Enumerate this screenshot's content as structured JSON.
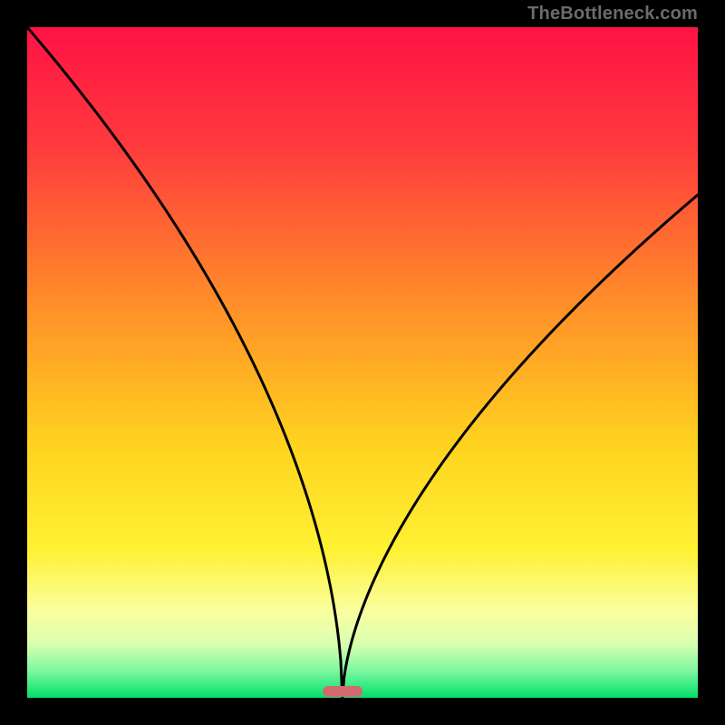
{
  "watermark": {
    "text": "TheBottleneck.com",
    "color": "#6b6b6b"
  },
  "chart_data": {
    "type": "line",
    "title": "",
    "xlabel": "",
    "ylabel": "",
    "xlim": [
      0,
      100
    ],
    "ylim": [
      0,
      100
    ],
    "minimum_x": 47,
    "x_samples": [
      0,
      5,
      10,
      15,
      20,
      25,
      30,
      35,
      40,
      43,
      45,
      46,
      47,
      48,
      49,
      51,
      55,
      60,
      65,
      70,
      75,
      80,
      85,
      90,
      95,
      100
    ],
    "series": [
      {
        "name": "left",
        "x_max": 47,
        "amp": 100,
        "exp": 0.55
      },
      {
        "name": "right",
        "x_min": 47,
        "amp": 75,
        "exp": 0.6
      }
    ],
    "marker": {
      "x_frac": 0.47,
      "y_frac": 0.991,
      "color": "#d36a6f"
    },
    "gradient_stops": [
      {
        "pos": 0.0,
        "color": "#ff1245"
      },
      {
        "pos": 0.18,
        "color": "#ff3b3d"
      },
      {
        "pos": 0.4,
        "color": "#ff8a2a"
      },
      {
        "pos": 0.62,
        "color": "#ffd21f"
      },
      {
        "pos": 0.78,
        "color": "#fff133"
      },
      {
        "pos": 0.87,
        "color": "#fbffa0"
      },
      {
        "pos": 0.92,
        "color": "#d9ffb0"
      },
      {
        "pos": 0.96,
        "color": "#7cf7a0"
      },
      {
        "pos": 1.0,
        "color": "#00e06a"
      }
    ],
    "curve_color": "#000000",
    "curve_width": 3
  }
}
